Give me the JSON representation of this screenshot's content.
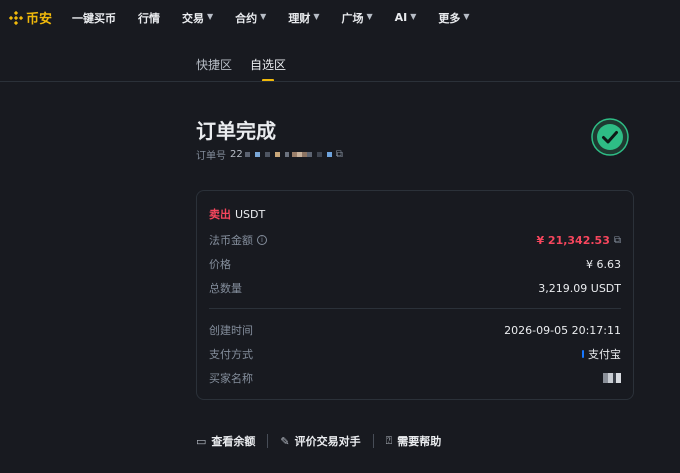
{
  "brand": {
    "name": "币安",
    "color": "#f0b90b"
  },
  "nav": {
    "items": [
      {
        "label": "一键买币",
        "dropdown": false
      },
      {
        "label": "行情",
        "dropdown": false
      },
      {
        "label": "交易",
        "dropdown": true
      },
      {
        "label": "合约",
        "dropdown": true
      },
      {
        "label": "理财",
        "dropdown": true
      },
      {
        "label": "广场",
        "dropdown": true
      },
      {
        "label": "AI",
        "dropdown": true
      },
      {
        "label": "更多",
        "dropdown": true
      }
    ]
  },
  "tabs": [
    {
      "label": "快捷区",
      "active": false
    },
    {
      "label": "自选区",
      "active": true
    }
  ],
  "order": {
    "title": "订单完成",
    "number_label": "订单号",
    "number_prefix": "22"
  },
  "card": {
    "side": "卖出",
    "asset": "USDT",
    "fiat_amount_label": "法币金额",
    "fiat_amount_value": "¥ 21,342.53",
    "price_label": "价格",
    "price_value": "¥ 6.63",
    "quantity_label": "总数量",
    "quantity_value": "3,219.09 USDT",
    "created_label": "创建时间",
    "created_value": "2026-09-05 20:17:11",
    "payment_label": "支付方式",
    "payment_value": "支付宝",
    "buyer_label": "买家名称"
  },
  "actions": {
    "view_balance": "查看余额",
    "rate_counterparty": "评价交易对手",
    "need_help": "需要帮助"
  },
  "colors": {
    "background": "#181a20",
    "accent": "#f0b90b",
    "sell": "#f6465d",
    "success": "#2ebd85"
  }
}
